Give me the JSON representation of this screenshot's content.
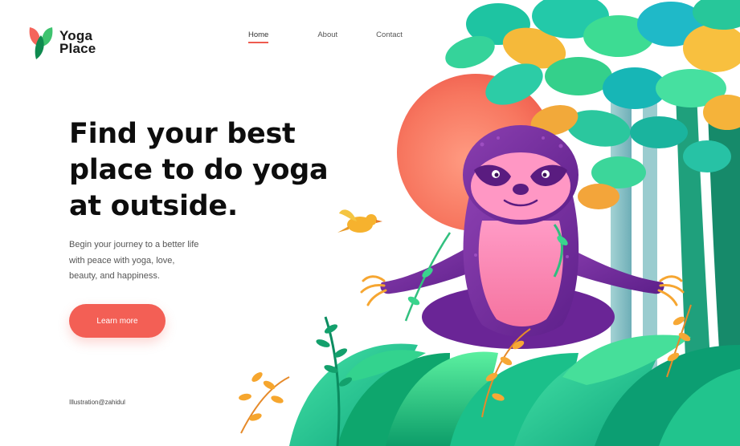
{
  "brand": {
    "name_line1": "Yoga",
    "name_line2": "Place",
    "logo_colors": [
      "#3ec36f",
      "#f5655b",
      "#0f8a4f"
    ]
  },
  "nav": {
    "items": [
      {
        "label": "Home",
        "active": true
      },
      {
        "label": "About",
        "active": false
      },
      {
        "label": "Contact",
        "active": false
      }
    ]
  },
  "hero": {
    "headline_line1": "Find your best",
    "headline_line2": "place to do yoga",
    "headline_line3": "at outside.",
    "sub_line1": "Begin your journey to a better life",
    "sub_line2": "with peace with yoga, love,",
    "sub_line3": "beauty, and happiness.",
    "cta_label": "Learn more",
    "cta_color": "#f35f55"
  },
  "footer": {
    "credit": "Illustration@zahidul"
  },
  "illustration": {
    "subject": "meditating sloth in jungle",
    "accent_colors": [
      "#f76b5e",
      "#7d3aa6",
      "#2ec98a",
      "#f4a62a"
    ]
  }
}
